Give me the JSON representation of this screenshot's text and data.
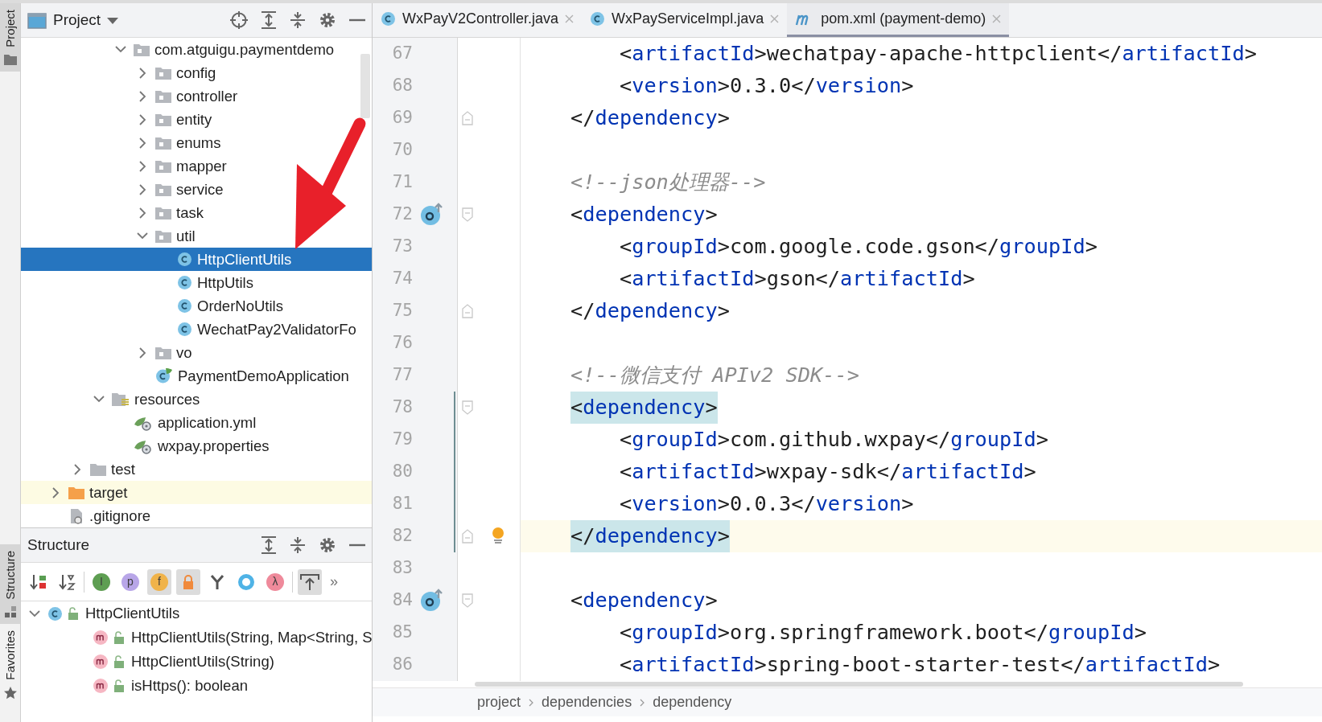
{
  "side_stripe": [
    {
      "label": "Project",
      "selected": true
    },
    {
      "label": "Structure",
      "selected": true
    },
    {
      "label": "Favorites",
      "selected": false
    }
  ],
  "project_panel": {
    "title": "Project",
    "tree": [
      {
        "children": [
          {
            "children": [
              {
                "children": [
                  {
                    "label": "com.atguigu.paymentdemo",
                    "kind": "package",
                    "expanded": true,
                    "selected": false,
                    "children": [
                      {
                        "label": "config",
                        "kind": "package",
                        "expanded": false,
                        "selected": false
                      },
                      {
                        "label": "controller",
                        "kind": "package",
                        "expanded": false,
                        "selected": false
                      },
                      {
                        "label": "entity",
                        "kind": "package",
                        "expanded": false,
                        "selected": false
                      },
                      {
                        "label": "enums",
                        "kind": "package",
                        "expanded": false,
                        "selected": false
                      },
                      {
                        "label": "mapper",
                        "kind": "package",
                        "expanded": false,
                        "selected": false
                      },
                      {
                        "label": "service",
                        "kind": "package",
                        "expanded": false,
                        "selected": false
                      },
                      {
                        "label": "task",
                        "kind": "package",
                        "expanded": false,
                        "selected": false
                      },
                      {
                        "label": "util",
                        "kind": "package",
                        "expanded": true,
                        "selected": false,
                        "children": [
                          {
                            "label": "HttpClientUtils",
                            "kind": "class",
                            "selected": true
                          },
                          {
                            "label": "HttpUtils",
                            "kind": "class",
                            "selected": false
                          },
                          {
                            "label": "OrderNoUtils",
                            "kind": "class",
                            "selected": false
                          },
                          {
                            "label": "WechatPay2ValidatorFo",
                            "kind": "class",
                            "selected": false
                          }
                        ]
                      },
                      {
                        "label": "vo",
                        "kind": "package",
                        "expanded": false,
                        "selected": false
                      },
                      {
                        "label": "PaymentDemoApplication",
                        "kind": "spring-class",
                        "selected": false
                      }
                    ]
                  }
                ]
              },
              {
                "label": "resources",
                "kind": "resources",
                "expanded": true,
                "selected": false,
                "children": [
                  {
                    "label": "application.yml",
                    "kind": "config-file",
                    "selected": false
                  },
                  {
                    "label": "wxpay.properties",
                    "kind": "config-file",
                    "selected": false
                  }
                ]
              }
            ]
          },
          {
            "label": "test",
            "kind": "folder",
            "expanded": false,
            "selected": false
          }
        ]
      },
      {
        "label": "target",
        "kind": "excluded",
        "expanded": false,
        "selected": false
      },
      {
        "label": ".gitignore",
        "kind": "ignore-file",
        "selected": false
      }
    ]
  },
  "structure_panel": {
    "title": "Structure",
    "toolbar": [
      {
        "kind": "sort-visibility",
        "on": false
      },
      {
        "kind": "sort-alpha",
        "on": false
      },
      {
        "kind": "badge",
        "glyph": "I",
        "color": "#5e9e52",
        "on": false
      },
      {
        "kind": "badge",
        "glyph": "p",
        "color": "#b8a6e8",
        "on": false
      },
      {
        "kind": "badge",
        "glyph": "f",
        "color": "#f0b34a",
        "on": true
      },
      {
        "kind": "lock",
        "on": true
      },
      {
        "kind": "fork",
        "on": false
      },
      {
        "kind": "ring",
        "on": false
      },
      {
        "kind": "badge",
        "glyph": "λ",
        "color": "#ef8a9b",
        "on": false
      },
      {
        "kind": "autoscroll",
        "on": true
      },
      {
        "kind": "more",
        "glyph": "»",
        "on": false
      }
    ],
    "tree": [
      {
        "label": "HttpClientUtils",
        "kind": "class",
        "expanded": true,
        "children": [
          {
            "label": "HttpClientUtils(String, Map<String, S",
            "kind": "method"
          },
          {
            "label": "HttpClientUtils(String)",
            "kind": "method"
          },
          {
            "label": "isHttps(): boolean",
            "kind": "method"
          }
        ]
      }
    ]
  },
  "tabs": [
    {
      "label": "WxPayV2Controller.java",
      "kind": "class",
      "selected": false
    },
    {
      "label": "WxPayServiceImpl.java",
      "kind": "class",
      "selected": false
    },
    {
      "label": "pom.xml (payment-demo)",
      "kind": "maven",
      "selected": true
    }
  ],
  "editor_lines": [
    {
      "number": "67",
      "kind": "tag",
      "code": "    <artifactId>wechatpay-apache-httpclient</artifactId>"
    },
    {
      "number": "68",
      "kind": "tag",
      "code": "    <version>0.3.0</version>"
    },
    {
      "number": "69",
      "kind": "tag",
      "code": "</dependency>",
      "fold_end": true
    },
    {
      "number": "70",
      "kind": "blank"
    },
    {
      "number": "71",
      "kind": "comment",
      "code": "<!--json处理器-->"
    },
    {
      "number": "72",
      "kind": "tag",
      "code": "<dependency>",
      "fold_start": true,
      "override": true
    },
    {
      "number": "73",
      "kind": "tag",
      "code": "    <groupId>com.google.code.gson</groupId>"
    },
    {
      "number": "74",
      "kind": "tag",
      "code": "    <artifactId>gson</artifactId>"
    },
    {
      "number": "75",
      "kind": "tag",
      "code": "</dependency>",
      "fold_end": true
    },
    {
      "number": "76",
      "kind": "blank"
    },
    {
      "number": "77",
      "kind": "comment",
      "code": "<!--微信支付 APIv2 SDK-->"
    },
    {
      "number": "78",
      "kind": "tag",
      "code": "<dependency>",
      "fold_start": true,
      "changed": true,
      "matched": true
    },
    {
      "number": "79",
      "kind": "tag",
      "code": "    <groupId>com.github.wxpay</groupId>",
      "changed": true
    },
    {
      "number": "80",
      "kind": "tag",
      "code": "    <artifactId>wxpay-sdk</artifactId>",
      "changed": true
    },
    {
      "number": "81",
      "kind": "tag",
      "code": "    <version>0.0.3</version>",
      "changed": true
    },
    {
      "number": "82",
      "kind": "tag",
      "code": "</dependency>",
      "fold_end": true,
      "changed": true,
      "matched": true,
      "current": true,
      "bulb": true
    },
    {
      "number": "83",
      "kind": "blank"
    },
    {
      "number": "84",
      "kind": "tag",
      "code": "<dependency>",
      "fold_start": true,
      "override": true
    },
    {
      "number": "85",
      "kind": "tag",
      "code": "    <groupId>org.springframework.boot</groupId>"
    },
    {
      "number": "86",
      "kind": "tag",
      "code": "    <artifactId>spring-boot-starter-test</artifactId>"
    }
  ],
  "breadcrumb": [
    "project",
    "dependencies",
    "dependency"
  ]
}
